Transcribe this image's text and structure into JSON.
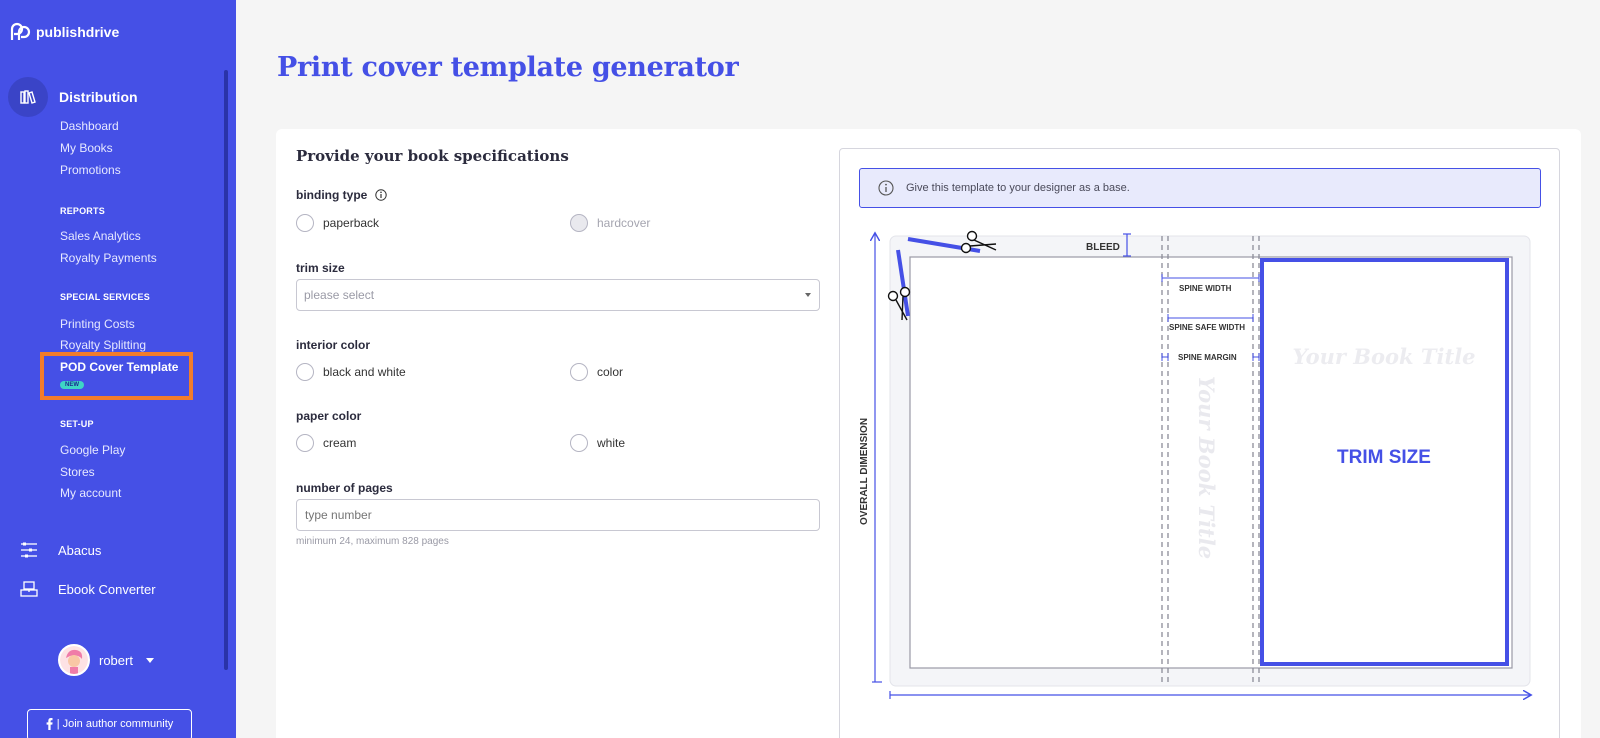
{
  "sidebar": {
    "brand": "publishdrive",
    "main_nav": "Distribution",
    "distribution_items": [
      "Dashboard",
      "My Books",
      "Promotions"
    ],
    "reports_heading": "REPORTS",
    "reports_items": [
      "Sales Analytics",
      "Royalty Payments"
    ],
    "special_heading": "SPECIAL SERVICES",
    "special_items": [
      "Printing Costs",
      "Royalty Splitting"
    ],
    "pod_label": "POD Cover Template",
    "pod_badge": "NEW",
    "setup_heading": "SET-UP",
    "setup_items": [
      "Google Play",
      "Stores",
      "My account"
    ],
    "abacus": "Abacus",
    "ebook_converter": "Ebook Converter",
    "user_name": "robert",
    "community": "| Join author community"
  },
  "page": {
    "title": "Print cover template generator"
  },
  "form": {
    "title": "Provide your book specifications",
    "binding_label": "binding type",
    "binding_options": [
      "paperback",
      "hardcover"
    ],
    "trim_label": "trim size",
    "trim_placeholder": "please select",
    "interior_label": "interior color",
    "interior_options": [
      "black and white",
      "color"
    ],
    "paper_label": "paper color",
    "paper_options": [
      "cream",
      "white"
    ],
    "pages_label": "number of pages",
    "pages_placeholder": "type number",
    "pages_hint": "minimum 24, maximum 828 pages"
  },
  "preview": {
    "info_text": "Give this template to your designer as a base.",
    "bleed": "BLEED",
    "spine_width": "SPINE WIDTH",
    "spine_safe_width": "SPINE SAFE WIDTH",
    "spine_margin": "SPINE MARGIN",
    "overall_dimension": "OVERALL DIMENSION",
    "book_title": "Your Book Title",
    "spine_title": "Your Book Title",
    "trim_size": "TRIM SIZE"
  },
  "colors": {
    "accent": "#4550e6",
    "highlight": "#f27c2b"
  }
}
